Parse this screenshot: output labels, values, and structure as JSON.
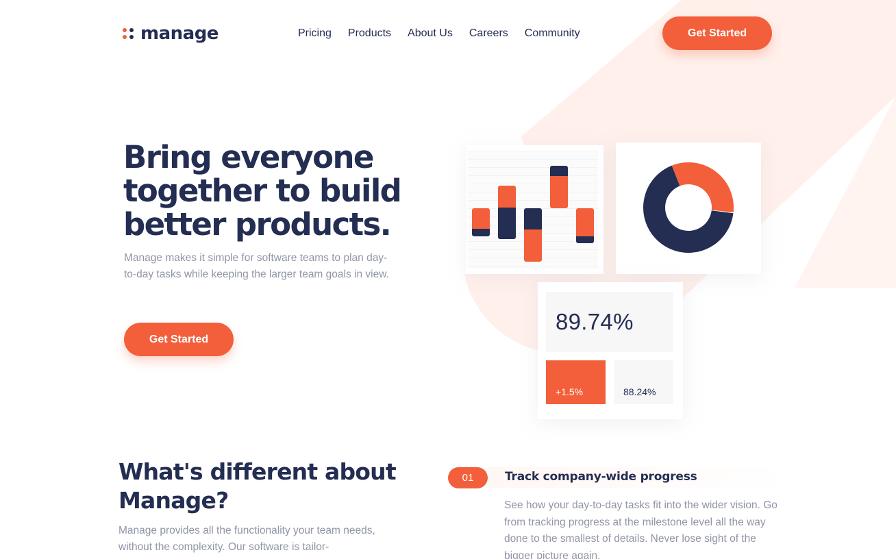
{
  "brand": {
    "name": "manage",
    "logo_icon": "four-dots-icon",
    "accent_color": "#F25F3A",
    "navy_color": "#242D52",
    "text_muted_color": "#9095A7",
    "background_tint": "#FFF0EB"
  },
  "nav": {
    "items": [
      {
        "label": "Pricing"
      },
      {
        "label": "Products"
      },
      {
        "label": "About Us"
      },
      {
        "label": "Careers"
      },
      {
        "label": "Community"
      }
    ],
    "cta_label": "Get Started"
  },
  "hero": {
    "title": "Bring everyone together to build better products.",
    "description": "Manage makes it simple for software teams to plan day-to-day tasks while keeping the larger team goals in view.",
    "cta_label": "Get Started"
  },
  "dashboard": {
    "donut_share_orange": 0.33,
    "big_stat": "89.74%",
    "change_stat": "+1.5%",
    "secondary_stat": "88.24%"
  },
  "features": {
    "heading": "What's different about Manage?",
    "description": "Manage provides all the functionality your team needs, without the complexity. Our software is tailor-",
    "items": [
      {
        "number": "01",
        "title": "Track company-wide progress",
        "description": "See how your day-to-day tasks fit into the wider vision. Go from tracking progress at the milestone level all the way done to the smallest of details. Never lose sight of the bigger picture again."
      }
    ]
  }
}
